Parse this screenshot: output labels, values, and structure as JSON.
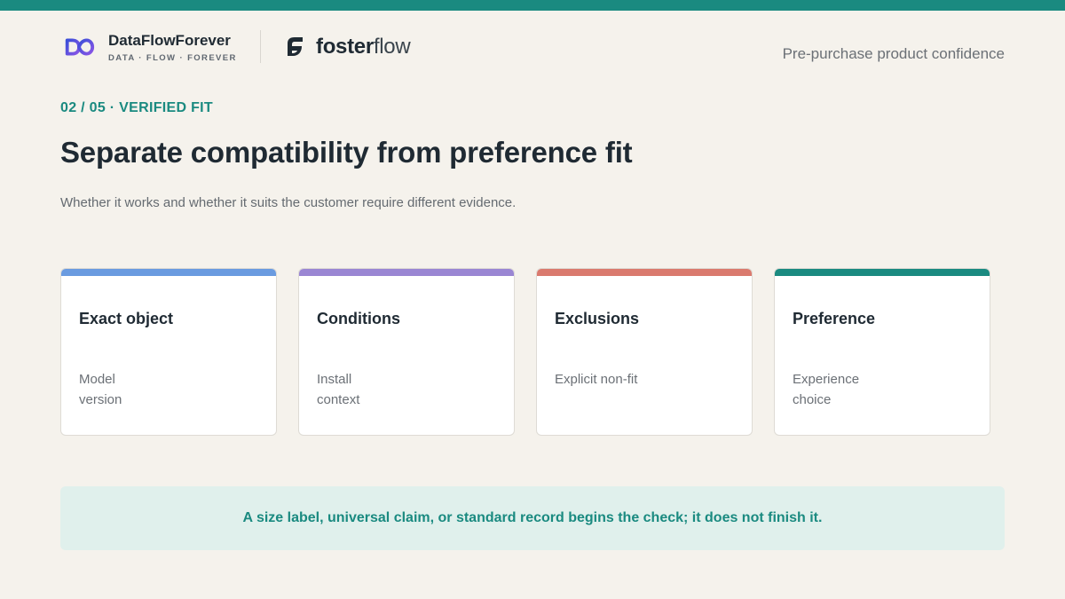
{
  "colors": {
    "accent": "#1a8a80",
    "background": "#f5f2ec",
    "callout_bg": "#e0f0ec"
  },
  "header": {
    "brand_name": "DataFlowForever",
    "brand_tagline": "DATA · FLOW · FOREVER",
    "brand_icon": "infinity-logo-icon",
    "partner_icon": "fosterflow-leaf-icon",
    "partner_name_bold": "foster",
    "partner_name_light": "flow",
    "tagline": "Pre-purchase product confidence"
  },
  "slide": {
    "kicker": "02 / 05 · VERIFIED FIT",
    "title": "Separate compatibility from preference fit",
    "subtitle": "Whether it works and whether it suits the customer require different evidence."
  },
  "cards": [
    {
      "title": "Exact object",
      "lines": [
        "Model",
        "version"
      ],
      "color": "#6a9be0"
    },
    {
      "title": "Conditions",
      "lines": [
        "Install",
        "context"
      ],
      "color": "#9a86d3"
    },
    {
      "title": "Exclusions",
      "lines": [
        "Explicit non-fit"
      ],
      "color": "#da7a6e"
    },
    {
      "title": "Preference",
      "lines": [
        "Experience",
        "choice"
      ],
      "color": "#1a8a80"
    }
  ],
  "callout": {
    "text": "A size label, universal claim, or standard record begins the check; it does not finish it."
  }
}
